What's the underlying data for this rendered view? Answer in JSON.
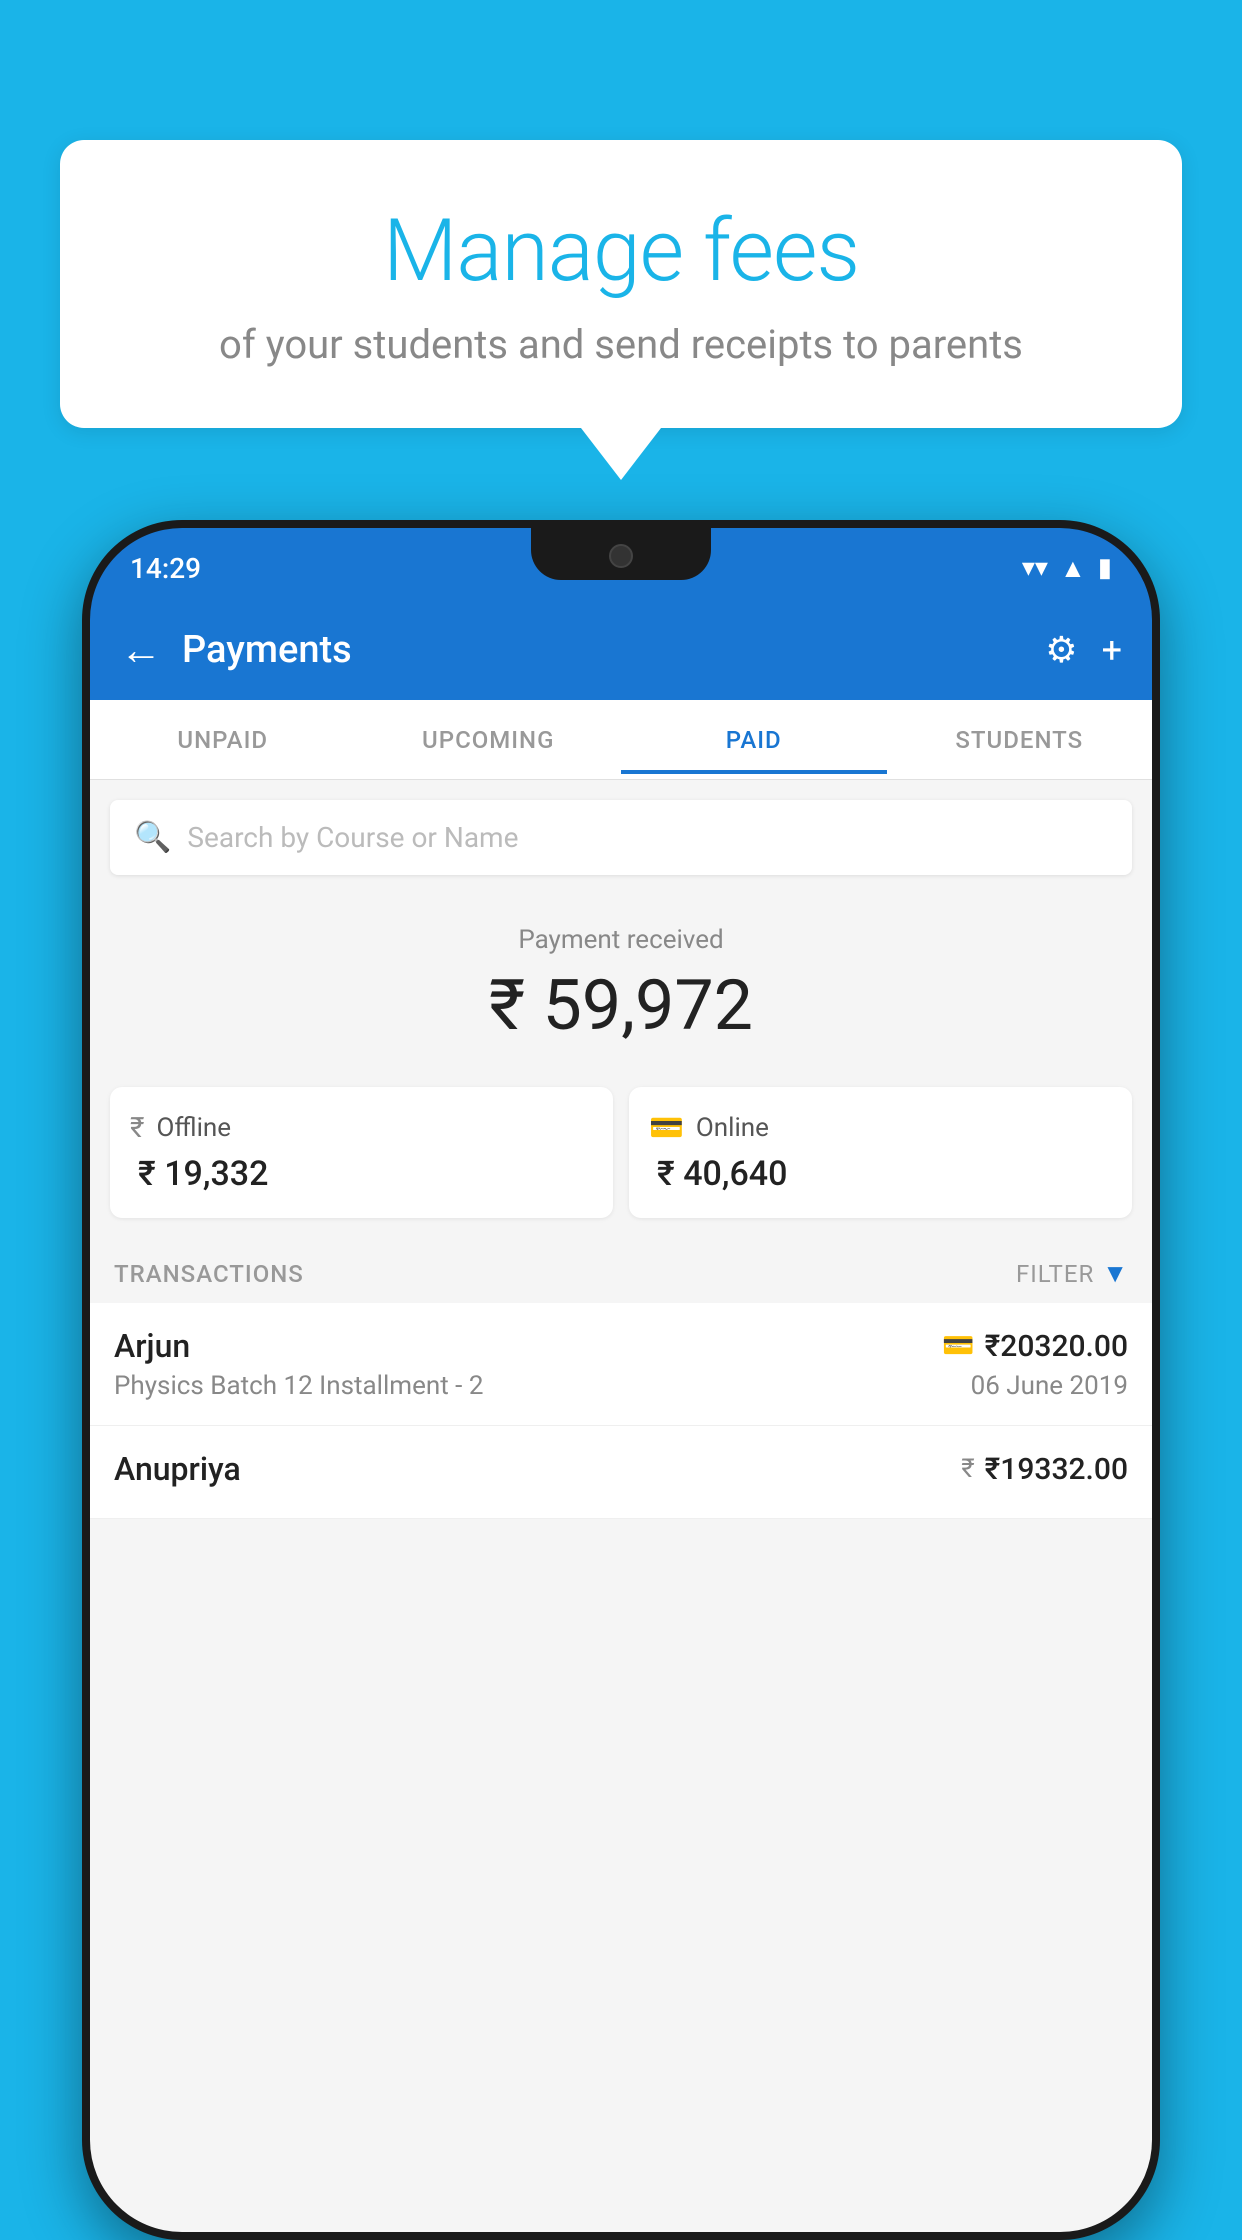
{
  "background_color": "#1ab4e8",
  "speech_bubble": {
    "title": "Manage fees",
    "subtitle": "of your students and send receipts to parents"
  },
  "status_bar": {
    "time": "14:29",
    "wifi_icon": "▼",
    "signal_icon": "▲",
    "battery_icon": "▮"
  },
  "app_bar": {
    "back_icon": "←",
    "title": "Payments",
    "gear_icon": "⚙",
    "plus_icon": "+"
  },
  "tabs": [
    {
      "label": "UNPAID",
      "active": false
    },
    {
      "label": "UPCOMING",
      "active": false
    },
    {
      "label": "PAID",
      "active": true
    },
    {
      "label": "STUDENTS",
      "active": false
    }
  ],
  "search": {
    "placeholder": "Search by Course or Name",
    "icon": "🔍"
  },
  "payment_received": {
    "label": "Payment received",
    "amount": "₹ 59,972"
  },
  "payment_cards": [
    {
      "type": "Offline",
      "amount": "₹ 19,332",
      "icon": "₹"
    },
    {
      "type": "Online",
      "amount": "₹ 40,640",
      "icon": "💳"
    }
  ],
  "transactions_section": {
    "label": "TRANSACTIONS",
    "filter_label": "FILTER",
    "filter_icon": "▼"
  },
  "transactions": [
    {
      "name": "Arjun",
      "amount": "₹20320.00",
      "type_icon": "card",
      "course": "Physics Batch 12 Installment - 2",
      "date": "06 June 2019"
    },
    {
      "name": "Anupriya",
      "amount": "₹19332.00",
      "type_icon": "cash",
      "course": "",
      "date": ""
    }
  ]
}
